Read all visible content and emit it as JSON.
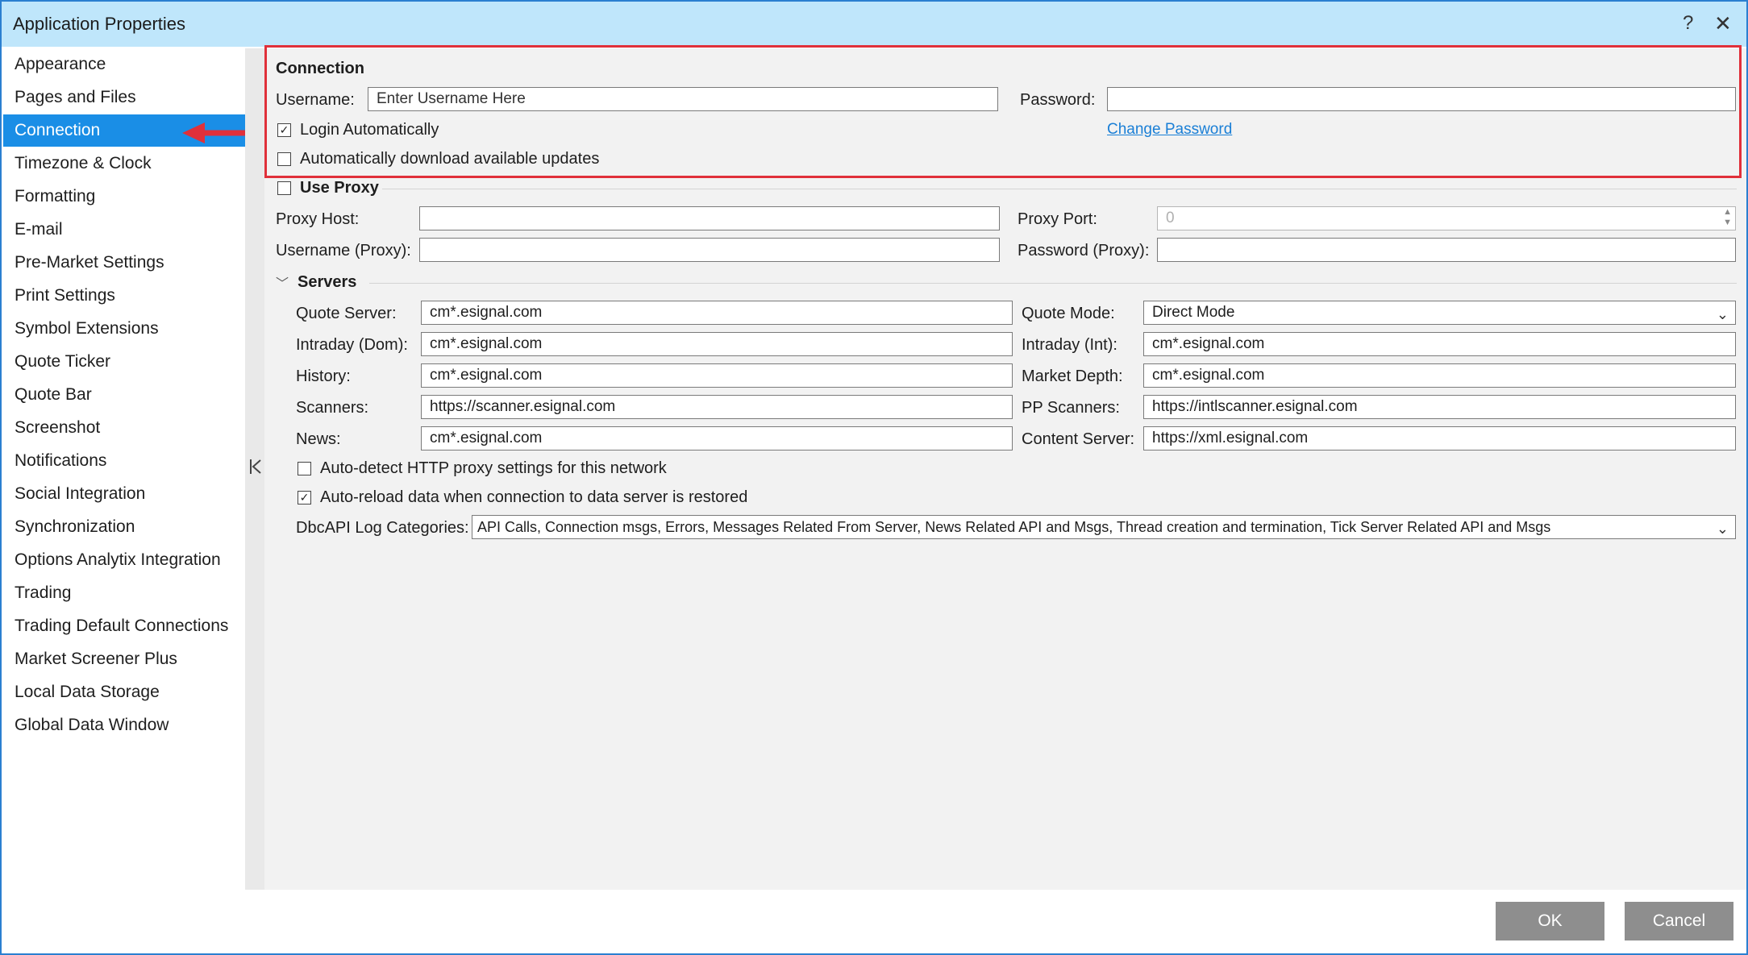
{
  "window": {
    "title": "Application Properties",
    "help_glyph": "?",
    "close_glyph": "✕"
  },
  "sidebar": {
    "selected": "Connection",
    "items": [
      {
        "label": "Appearance"
      },
      {
        "label": "Pages and Files"
      },
      {
        "label": "Connection"
      },
      {
        "label": "Timezone & Clock"
      },
      {
        "label": "Formatting"
      },
      {
        "label": "E-mail"
      },
      {
        "label": "Pre-Market Settings"
      },
      {
        "label": "Print Settings"
      },
      {
        "label": "Symbol Extensions"
      },
      {
        "label": "Quote Ticker"
      },
      {
        "label": "Quote Bar"
      },
      {
        "label": "Screenshot"
      },
      {
        "label": "Notifications"
      },
      {
        "label": "Social Integration"
      },
      {
        "label": "Synchronization"
      },
      {
        "label": "Options Analytix Integration"
      },
      {
        "label": "Trading"
      },
      {
        "label": "Trading Default Connections"
      },
      {
        "label": "Market Screener Plus"
      },
      {
        "label": "Local Data Storage"
      },
      {
        "label": "Global Data Window"
      }
    ]
  },
  "connection": {
    "heading": "Connection",
    "username_label": "Username:",
    "username_value": "Enter Username Here",
    "password_label": "Password:",
    "password_value": "",
    "login_auto_label": "Login Automatically",
    "login_auto_checked": true,
    "change_password_link": "Change Password",
    "auto_download_label": "Automatically download available updates",
    "auto_download_checked": false
  },
  "proxy": {
    "use_proxy_label": "Use Proxy",
    "use_proxy_checked": false,
    "host_label": "Proxy Host:",
    "host_value": "",
    "port_label": "Proxy Port:",
    "port_value": "0",
    "username_label": "Username (Proxy):",
    "username_value": "",
    "password_label": "Password (Proxy):",
    "password_value": ""
  },
  "servers": {
    "heading": "Servers",
    "expanded": true,
    "quote_server_label": "Quote Server:",
    "quote_server_value": "cm*.esignal.com",
    "quote_mode_label": "Quote Mode:",
    "quote_mode_value": "Direct Mode",
    "intraday_dom_label": "Intraday (Dom):",
    "intraday_dom_value": "cm*.esignal.com",
    "intraday_int_label": "Intraday (Int):",
    "intraday_int_value": "cm*.esignal.com",
    "history_label": "History:",
    "history_value": "cm*.esignal.com",
    "market_depth_label": "Market Depth:",
    "market_depth_value": "cm*.esignal.com",
    "scanners_label": "Scanners:",
    "scanners_value": "https://scanner.esignal.com",
    "pp_scanners_label": "PP Scanners:",
    "pp_scanners_value": "https://intlscanner.esignal.com",
    "news_label": "News:",
    "news_value": "cm*.esignal.com",
    "content_server_label": "Content Server:",
    "content_server_value": "https://xml.esignal.com",
    "auto_detect_label": "Auto-detect HTTP proxy settings for this network",
    "auto_detect_checked": false,
    "auto_reload_label": "Auto-reload data when connection to data server is restored",
    "auto_reload_checked": true,
    "log_categories_label": "DbcAPI Log Categories:",
    "log_categories_value": "API Calls, Connection msgs, Errors, Messages Related From Server, News Related API and Msgs, Thread creation and termination, Tick Server Related API and Msgs"
  },
  "footer": {
    "ok_label": "OK",
    "cancel_label": "Cancel"
  },
  "colors": {
    "titlebar": "#bfe6fb",
    "selected_item": "#1a8ee6",
    "highlight_border": "#e0303a",
    "link": "#1a7fd6",
    "button": "#8e8e8e"
  }
}
